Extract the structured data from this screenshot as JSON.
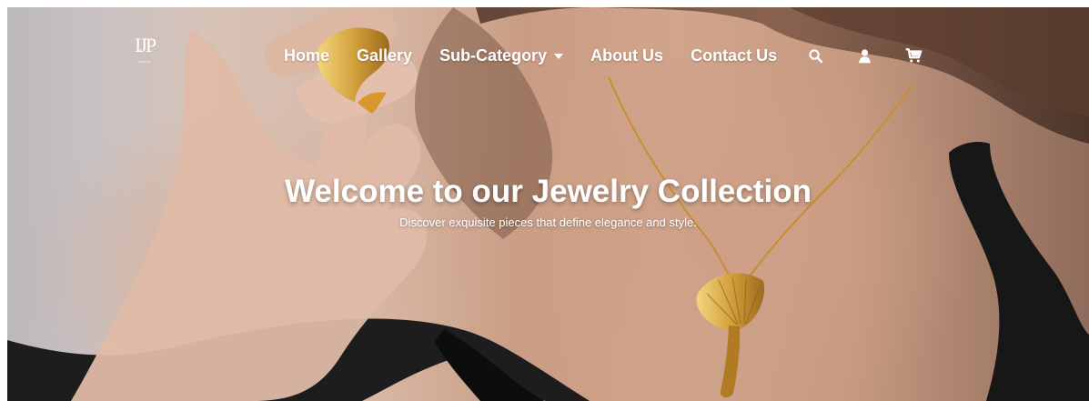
{
  "brand": {
    "logo_mark": "IJP",
    "logo_subtext": "JEWELRY"
  },
  "nav": {
    "items": [
      {
        "label": "Home"
      },
      {
        "label": "Gallery"
      },
      {
        "label": "Sub-Category",
        "dropdown": true
      },
      {
        "label": "About Us"
      },
      {
        "label": "Contact Us"
      }
    ],
    "icons": [
      "search-icon",
      "user-icon",
      "cart-icon"
    ]
  },
  "hero": {
    "title": "Welcome to our Jewelry Collection",
    "subtitle": "Discover exquisite pieces that define elegance and style."
  },
  "colors": {
    "text": "#ffffff",
    "gold": "#d6a33f",
    "skin": "#d8aa8e",
    "hair": "#6e4a36",
    "top": "#191919",
    "wall": "#c1bbbe"
  }
}
